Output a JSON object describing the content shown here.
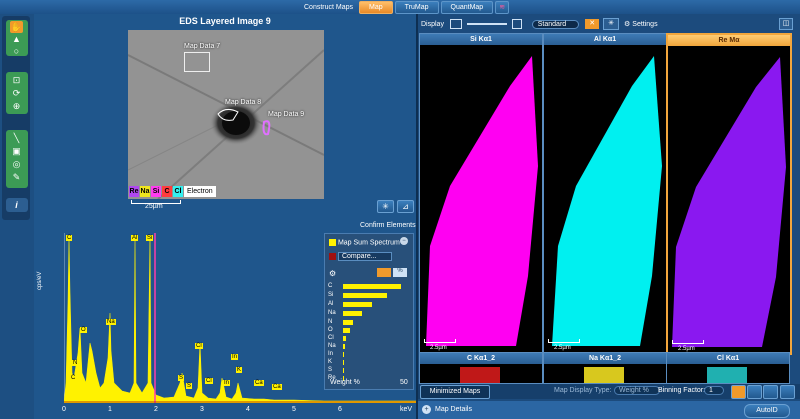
{
  "toolbar": {
    "label": "Construct Maps",
    "buttons": [
      "Map",
      "TruMap",
      "QuantMap"
    ],
    "active": "Map"
  },
  "image_panel": {
    "title": "EDS Layered Image 9",
    "map_labels": [
      "Map Data 7",
      "Map Data 8",
      "Map Data 9"
    ],
    "legend": [
      {
        "label": "Re",
        "color": "#b048f0"
      },
      {
        "label": "Na",
        "color": "#f0e61e"
      },
      {
        "label": "Si",
        "color": "#ff3cf0"
      },
      {
        "label": "C",
        "color": "#ff3c3c"
      },
      {
        "label": "Cl",
        "color": "#34f0f0"
      }
    ],
    "legend_extra": "Electron",
    "scale": "25µm",
    "confirm": "Confirm Elements"
  },
  "spectrum": {
    "ylabel": "cps/eV",
    "xlabel": "keV",
    "xticks": [
      "0",
      "1",
      "2",
      "3",
      "4",
      "5",
      "6"
    ],
    "peak_labels": [
      "C",
      "O",
      "N",
      "Na",
      "Al",
      "Si",
      "S",
      "S",
      "Cl",
      "Cl",
      "In",
      "In",
      "Ca",
      "Ca",
      "K",
      "C"
    ],
    "panel": {
      "series": "Map Sum Spectrum",
      "compare": "Compare...",
      "elements": [
        "C",
        "Si",
        "Al",
        "Na",
        "N",
        "O",
        "Cl",
        "Na",
        "In",
        "K",
        "S",
        "Re"
      ],
      "weights": [
        1.0,
        0.75,
        0.5,
        0.32,
        0.18,
        0.12,
        0.05,
        0.03,
        0.02,
        0.02,
        0.02,
        0.0
      ],
      "footer_left": "Weight %",
      "footer_right": "50"
    }
  },
  "maps": {
    "display_label": "Display",
    "dropdown": "Standard",
    "settings": "Settings",
    "tiles": [
      {
        "name": "Si Kα1",
        "color": "#ff00f2"
      },
      {
        "name": "Al Kα1",
        "color": "#00f0f0"
      },
      {
        "name": "Re Mα",
        "color": "#8a18f0"
      }
    ],
    "tiles2": [
      {
        "name": "C Kα1_2",
        "color": "#c01818"
      },
      {
        "name": "Na Kα1_2",
        "color": "#d8c81e"
      },
      {
        "name": "Cl Kα1",
        "color": "#20b0b0"
      }
    ],
    "scale": "2.5µm",
    "minimized": "Minimized Maps",
    "display_type_label": "Map Display Type:",
    "display_type": "Weight %",
    "binning_label": "Binning Factor:",
    "binning": "1",
    "details": "Map Details",
    "autoid": "AutoID"
  }
}
